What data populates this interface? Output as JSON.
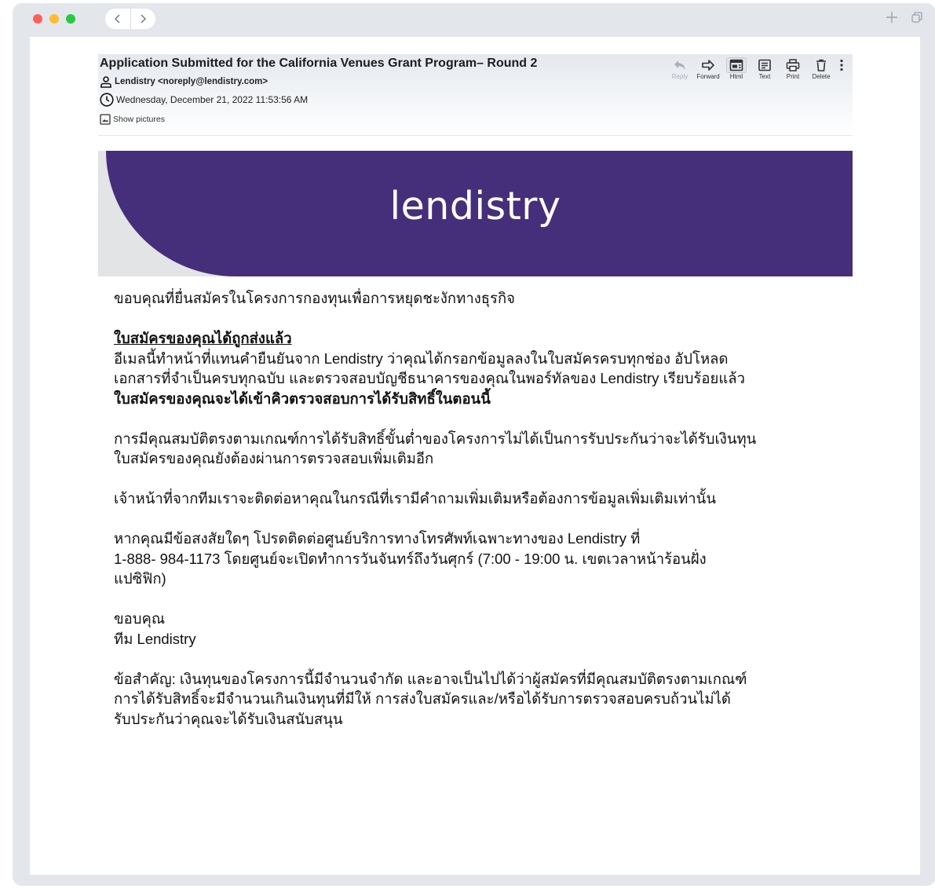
{
  "browser": {
    "nav": {
      "back_icon": "chevron-left-icon",
      "forward_icon": "chevron-right-icon"
    },
    "controls": {
      "new_tab_icon": "plus-icon",
      "tabs_icon": "tab-overview-icon"
    }
  },
  "email": {
    "subject": "Application Submitted for the California Venues Grant Program– Round 2",
    "from": "Lendistry <noreply@lendistry.com>",
    "date": "Wednesday, December 21, 2022 11:53:56 AM",
    "show_pictures": "Show pictures",
    "toolbar": {
      "reply": "Reply",
      "forward": "Forward",
      "html": "Html",
      "text": "Text",
      "print": "Print",
      "delete": "Delete"
    }
  },
  "banner": {
    "logo_text": "lendistry",
    "colors": {
      "purple": "#452f7b",
      "grey": "#e2e4e6"
    }
  },
  "message": {
    "intro": "ขอบคุณที่ยื่นสมัครในโครงการกองทุนเพื่อการหยุดชะงักทางธุรกิจ",
    "heading": "ใบสมัครของคุณได้ถูกส่งแล้ว",
    "p1_line1": "อีเมลนี้ทำหน้าที่แทนคำยืนยันจาก Lendistry ว่าคุณได้กรอกข้อมูลลงในใบสมัครครบทุกช่อง อัปโหลด",
    "p1_line2": "เอกสารที่จำเป็นครบทุกฉบับ และตรวจสอบบัญชีธนาคารของคุณในพอร์ทัลของ Lendistry เรียบร้อยแล้ว",
    "p1_bold": "ใบสมัครของคุณจะได้เข้าคิวตรวจสอบการได้รับสิทธิ์ในตอนนี้",
    "p2_line1": "การมีคุณสมบัติตรงตามเกณฑ์การได้รับสิทธิ์ขั้นต่ำของโครงการไม่ได้เป็นการรับประกันว่าจะได้รับเงินทุน",
    "p2_line2": "ใบสมัครของคุณยังต้องผ่านการตรวจสอบเพิ่มเติมอีก",
    "p3": "เจ้าหน้าที่จากทีมเราจะติดต่อหาคุณในกรณีที่เรามีคำถามเพิ่มเติมหรือต้องการข้อมูลเพิ่มเติมเท่านั้น",
    "p4_line1": "หากคุณมีข้อสงสัยใดๆ โปรดติดต่อศูนย์บริการทางโทรศัพท์เฉพาะทางของ Lendistry ที่",
    "p4_line2": "1-888- 984-1173 โดยศูนย์จะเปิดทำการวันจันทร์ถึงวันศุกร์ (7:00 - 19:00 น. เขตเวลาหน้าร้อนฝั่ง",
    "p4_line3": "แปซิฟิก)",
    "closing": "ขอบคุณ",
    "signature": "ทีม Lendistry",
    "p5_line1": "ข้อสำคัญ: เงินทุนของโครงการนี้มีจำนวนจำกัด และอาจเป็นไปได้ว่าผู้สมัครที่มีคุณสมบัติตรงตามเกณฑ์",
    "p5_line2": "การได้รับสิทธิ์จะมีจำนวนเกินเงินทุนที่มีให้ การส่งใบสมัครและ/หรือได้รับการตรวจสอบครบถ้วนไม่ได้",
    "p5_line3": "รับประกันว่าคุณจะได้รับเงินสนับสนุน"
  }
}
